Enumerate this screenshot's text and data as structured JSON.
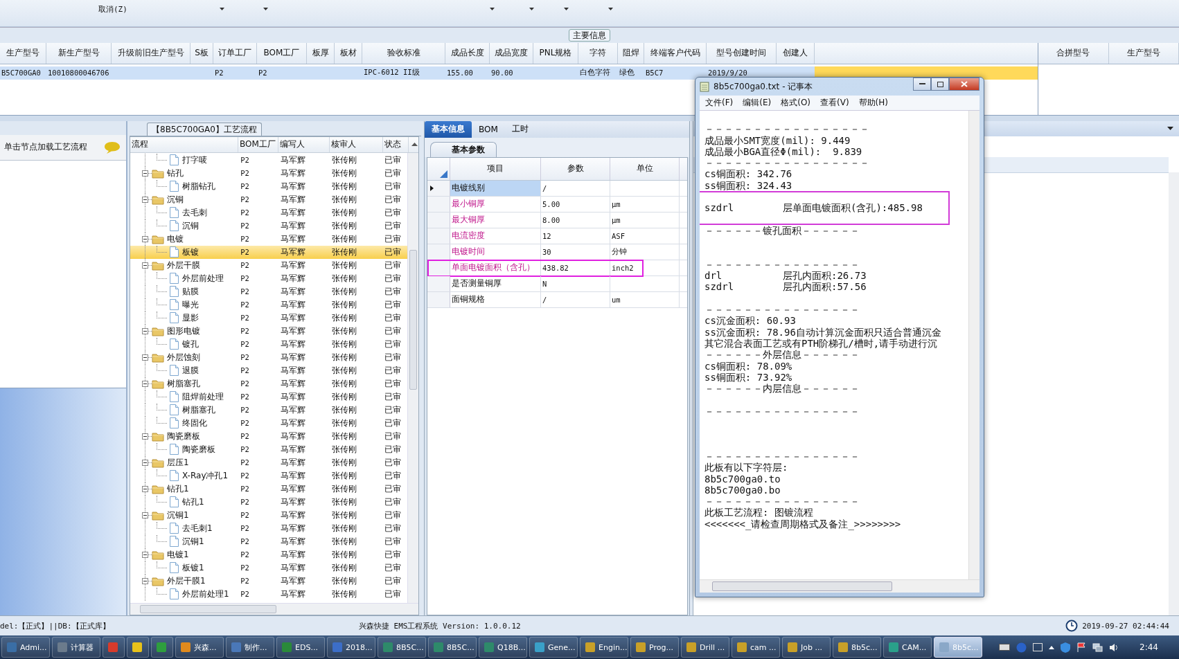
{
  "toolbar": {
    "cancel_label": "取消(Z)"
  },
  "main_info": {
    "title": "主要信息",
    "row_selected": true,
    "columns": [
      {
        "label": "生产型号",
        "value": "B5C700GA0"
      },
      {
        "label": "新生产型号",
        "value": "10010800046706"
      },
      {
        "label": "升级前旧生产型号"
      },
      {
        "label": "S板"
      },
      {
        "label": "订单工厂",
        "value": "P2"
      },
      {
        "label": "BOM工厂",
        "value": "P2"
      },
      {
        "label": "板厚"
      },
      {
        "label": "板材"
      },
      {
        "label": "验收标准",
        "value": "IPC-6012 II级"
      },
      {
        "label": "成品长度",
        "value": "155.00"
      },
      {
        "label": "成品宽度",
        "value": "90.00"
      },
      {
        "label": "PNL规格"
      },
      {
        "label": "字符",
        "value": "白色字符"
      },
      {
        "label": "阻焊",
        "value": "绿色"
      },
      {
        "label": "终端客户代码",
        "value": "B5C7"
      },
      {
        "label": "型号创建时间",
        "value": "2019/9/20"
      },
      {
        "label": "创建人"
      }
    ],
    "side_columns": [
      "合拼型号",
      "生产型号"
    ]
  },
  "left_panel": {
    "hint": "单击节点加载工艺流程"
  },
  "tree_panel": {
    "title": "【8B5C700GA0】工艺流程",
    "columns": [
      "流程",
      "BOM工厂",
      "编写人",
      "核审人",
      "状态"
    ],
    "nodes": [
      {
        "name": "打字唛",
        "kind": "file",
        "bom": "P2",
        "writer": "马军辉",
        "reviewer": "张传刚",
        "status": "已审",
        "selected": false
      },
      {
        "name": "钻孔",
        "kind": "folder",
        "expanded": true,
        "bom": "P2",
        "writer": "马军辉",
        "reviewer": "张传刚",
        "status": "已审",
        "selected": false,
        "children": [
          {
            "name": "树脂钻孔",
            "kind": "file",
            "bom": "P2",
            "writer": "马军辉",
            "reviewer": "张传刚",
            "status": "已审",
            "selected": false
          }
        ]
      },
      {
        "name": "沉铜",
        "kind": "folder",
        "expanded": true,
        "bom": "P2",
        "writer": "马军辉",
        "reviewer": "张传刚",
        "status": "已审",
        "selected": false,
        "children": [
          {
            "name": "去毛刺",
            "kind": "file",
            "bom": "P2",
            "writer": "马军辉",
            "reviewer": "张传刚",
            "status": "已审",
            "selected": false
          },
          {
            "name": "沉铜",
            "kind": "file",
            "bom": "P2",
            "writer": "马军辉",
            "reviewer": "张传刚",
            "status": "已审",
            "selected": false
          }
        ]
      },
      {
        "name": "电镀",
        "kind": "folder",
        "expanded": true,
        "bom": "P2",
        "writer": "马军辉",
        "reviewer": "张传刚",
        "status": "已审",
        "selected": false,
        "children": [
          {
            "name": "板镀",
            "kind": "file",
            "bom": "P2",
            "writer": "马军辉",
            "reviewer": "张传刚",
            "status": "已审",
            "selected": true
          }
        ]
      },
      {
        "name": "外层干膜",
        "kind": "folder",
        "expanded": true,
        "bom": "P2",
        "writer": "马军辉",
        "reviewer": "张传刚",
        "status": "已审",
        "selected": false,
        "children": [
          {
            "name": "外层前处理",
            "kind": "file",
            "bom": "P2",
            "writer": "马军辉",
            "reviewer": "张传刚",
            "status": "已审",
            "selected": false
          },
          {
            "name": "贴膜",
            "kind": "file",
            "bom": "P2",
            "writer": "马军辉",
            "reviewer": "张传刚",
            "status": "已审",
            "selected": false
          },
          {
            "name": "曝光",
            "kind": "file",
            "bom": "P2",
            "writer": "马军辉",
            "reviewer": "张传刚",
            "status": "已审",
            "selected": false
          },
          {
            "name": "显影",
            "kind": "file",
            "bom": "P2",
            "writer": "马军辉",
            "reviewer": "张传刚",
            "status": "已审",
            "selected": false
          }
        ]
      },
      {
        "name": "图形电镀",
        "kind": "folder",
        "expanded": true,
        "bom": "P2",
        "writer": "马军辉",
        "reviewer": "张传刚",
        "status": "已审",
        "selected": false,
        "children": [
          {
            "name": "镀孔",
            "kind": "file",
            "bom": "P2",
            "writer": "马军辉",
            "reviewer": "张传刚",
            "status": "已审",
            "selected": false
          }
        ]
      },
      {
        "name": "外层蚀刻",
        "kind": "folder",
        "expanded": true,
        "bom": "P2",
        "writer": "马军辉",
        "reviewer": "张传刚",
        "status": "已审",
        "selected": false,
        "children": [
          {
            "name": "退膜",
            "kind": "file",
            "bom": "P2",
            "writer": "马军辉",
            "reviewer": "张传刚",
            "status": "已审",
            "selected": false
          }
        ]
      },
      {
        "name": "树脂塞孔",
        "kind": "folder",
        "expanded": true,
        "bom": "P2",
        "writer": "马军辉",
        "reviewer": "张传刚",
        "status": "已审",
        "selected": false,
        "children": [
          {
            "name": "阻焊前处理",
            "kind": "file",
            "bom": "P2",
            "writer": "马军辉",
            "reviewer": "张传刚",
            "status": "已审",
            "selected": false
          },
          {
            "name": "树脂塞孔",
            "kind": "file",
            "bom": "P2",
            "writer": "马军辉",
            "reviewer": "张传刚",
            "status": "已审",
            "selected": false
          },
          {
            "name": "终固化",
            "kind": "file",
            "bom": "P2",
            "writer": "马军辉",
            "reviewer": "张传刚",
            "status": "已审",
            "selected": false
          }
        ]
      },
      {
        "name": "陶瓷磨板",
        "kind": "folder",
        "expanded": true,
        "bom": "P2",
        "writer": "马军辉",
        "reviewer": "张传刚",
        "status": "已审",
        "selected": false,
        "children": [
          {
            "name": "陶瓷磨板",
            "kind": "file",
            "bom": "P2",
            "writer": "马军辉",
            "reviewer": "张传刚",
            "status": "已审",
            "selected": false
          }
        ]
      },
      {
        "name": "层压1",
        "kind": "folder",
        "expanded": true,
        "bom": "P2",
        "writer": "马军辉",
        "reviewer": "张传刚",
        "status": "已审",
        "selected": false,
        "children": [
          {
            "name": "X-Ray冲孔1",
            "kind": "file",
            "bom": "P2",
            "writer": "马军辉",
            "reviewer": "张传刚",
            "status": "已审",
            "selected": false
          }
        ]
      },
      {
        "name": "钻孔1",
        "kind": "folder",
        "expanded": true,
        "bom": "P2",
        "writer": "马军辉",
        "reviewer": "张传刚",
        "status": "已审",
        "selected": false,
        "children": [
          {
            "name": "钻孔1",
            "kind": "file",
            "bom": "P2",
            "writer": "马军辉",
            "reviewer": "张传刚",
            "status": "已审",
            "selected": false
          }
        ]
      },
      {
        "name": "沉铜1",
        "kind": "folder",
        "expanded": true,
        "bom": "P2",
        "writer": "马军辉",
        "reviewer": "张传刚",
        "status": "已审",
        "selected": false,
        "children": [
          {
            "name": "去毛刺1",
            "kind": "file",
            "bom": "P2",
            "writer": "马军辉",
            "reviewer": "张传刚",
            "status": "已审",
            "selected": false
          },
          {
            "name": "沉铜1",
            "kind": "file",
            "bom": "P2",
            "writer": "马军辉",
            "reviewer": "张传刚",
            "status": "已审",
            "selected": false
          }
        ]
      },
      {
        "name": "电镀1",
        "kind": "folder",
        "expanded": true,
        "bom": "P2",
        "writer": "马军辉",
        "reviewer": "张传刚",
        "status": "已审",
        "selected": false,
        "children": [
          {
            "name": "板镀1",
            "kind": "file",
            "bom": "P2",
            "writer": "马军辉",
            "reviewer": "张传刚",
            "status": "已审",
            "selected": false
          }
        ]
      },
      {
        "name": "外层干膜1",
        "kind": "folder",
        "expanded": true,
        "bom": "P2",
        "writer": "马军辉",
        "reviewer": "张传刚",
        "status": "已审",
        "selected": false,
        "children": [
          {
            "name": "外层前处理1",
            "kind": "file",
            "bom": "P2",
            "writer": "马军辉",
            "reviewer": "张传刚",
            "status": "已审",
            "selected": false
          }
        ]
      }
    ]
  },
  "detail_panel": {
    "tabs": [
      {
        "label": "基本信息",
        "selected": true
      },
      {
        "label": "BOM",
        "selected": false
      },
      {
        "label": "工时",
        "selected": false
      }
    ],
    "subtab": "基本参数",
    "columns": [
      "项目",
      "参数",
      "单位"
    ],
    "rows": [
      {
        "item": "电镀线别",
        "value": "/",
        "required": false,
        "selected": true,
        "highlighted": false
      },
      {
        "item": "最小铜厚",
        "value": "5.00",
        "unit": "μm",
        "required": true,
        "selected": false,
        "highlighted": false
      },
      {
        "item": "最大铜厚",
        "value": "8.00",
        "unit": "μm",
        "required": true,
        "selected": false,
        "highlighted": false
      },
      {
        "item": "电流密度",
        "value": "12",
        "unit": "ASF",
        "required": true,
        "selected": false,
        "highlighted": false
      },
      {
        "item": "电镀时间",
        "value": "30",
        "unit": "分钟",
        "required": true,
        "selected": false,
        "highlighted": false
      },
      {
        "item": "单面电镀面积（含孔）",
        "value": "438.82",
        "unit": "inch2",
        "required": true,
        "selected": false,
        "highlighted": true
      },
      {
        "item": "是否测量铜厚",
        "value": "N",
        "required": false,
        "selected": false,
        "highlighted": false
      },
      {
        "item": "面铜规格",
        "value": "/",
        "unit": "um",
        "required": false,
        "selected": false,
        "highlighted": false
      }
    ]
  },
  "notepad": {
    "title": "8b5c700ga0.txt - 记事本",
    "menu": [
      "文件(F)",
      "编辑(E)",
      "格式(O)",
      "查看(V)",
      "帮助(H)"
    ],
    "lines": [
      {
        "kind": "blank"
      },
      {
        "kind": "text",
        "text": "－－－－－－－－－－－－－－－－－"
      },
      {
        "kind": "text",
        "text": "成品最小SMT宽度(mil): 9.449"
      },
      {
        "kind": "text",
        "text": "成品最小BGA直径Φ(mil):  9.839"
      },
      {
        "kind": "text",
        "text": "－－－－－－－－－－－－－－－－－"
      },
      {
        "kind": "text",
        "text": "cs铜面积: 342.76"
      },
      {
        "kind": "text",
        "text": "ss铜面积: 324.43"
      },
      {
        "kind": "text",
        "text": "szdrl\t层单面电镀面积(含孔):485.98",
        "highlighted": true
      },
      {
        "kind": "text",
        "text": "－－－－－－镀孔面积－－－－－－"
      },
      {
        "kind": "blank"
      },
      {
        "kind": "blank"
      },
      {
        "kind": "text",
        "text": "－－－－－－－－－－－－－－－－"
      },
      {
        "kind": "text",
        "text": "drl\t层孔内面积:26.73"
      },
      {
        "kind": "text",
        "text": "szdrl\t层孔内面积:57.56"
      },
      {
        "kind": "blank"
      },
      {
        "kind": "text",
        "text": "－－－－－－－－－－－－－－－－"
      },
      {
        "kind": "text",
        "text": "cs沉金面积: 60.93"
      },
      {
        "kind": "text",
        "text": "ss沉金面积: 78.96自动计算沉金面积只适合普通沉金"
      },
      {
        "kind": "text",
        "text": "其它混合表面工艺或有PTH阶梯孔/槽时,请手动进行沉"
      },
      {
        "kind": "text",
        "text": "－－－－－－外层信息－－－－－－"
      },
      {
        "kind": "text",
        "text": "cs铜面积: 78.09%"
      },
      {
        "kind": "text",
        "text": "ss铜面积: 73.92%"
      },
      {
        "kind": "text",
        "text": "－－－－－－内层信息－－－－－－"
      },
      {
        "kind": "blank"
      },
      {
        "kind": "text",
        "text": "－－－－－－－－－－－－－－－－"
      },
      {
        "kind": "blank"
      },
      {
        "kind": "blank"
      },
      {
        "kind": "blank"
      },
      {
        "kind": "text",
        "text": "－－－－－－－－－－－－－－－－"
      },
      {
        "kind": "text",
        "text": "此板有以下字符层:"
      },
      {
        "kind": "text",
        "text": "8b5c700ga0.to"
      },
      {
        "kind": "text",
        "text": "8b5c700ga0.bo"
      },
      {
        "kind": "text",
        "text": "－－－－－－－－－－－－－－－－"
      },
      {
        "kind": "text",
        "text": "此板工艺流程: 图镀流程"
      },
      {
        "kind": "text",
        "text": "<<<<<<<_请检查周期格式及备注_>>>>>>>>"
      }
    ]
  },
  "status_bar": {
    "mode": "del:【正式】||DB:【正式库】",
    "app": "兴森快捷 EMS工程系统 Version: 1.0.0.12",
    "datetime": "2019-09-27 02:44:44"
  },
  "taskbar": {
    "clock": "2:44",
    "items": [
      {
        "label": "Admi...",
        "color": "#3a6ea5",
        "selected": false
      },
      {
        "label": "计算器",
        "color": "#6b7b8c",
        "selected": false
      },
      {
        "color": "#d83b2b",
        "selected": false
      },
      {
        "color": "#e8c21a",
        "selected": false
      },
      {
        "color": "#2e9e3e",
        "selected": false
      },
      {
        "label": "兴森...",
        "color": "#e08a1e",
        "selected": false
      },
      {
        "label": "制作...",
        "color": "#4a78b8",
        "selected": false
      },
      {
        "label": "EDS...",
        "color": "#2a8a3a",
        "selected": false
      },
      {
        "label": "2018...",
        "color": "#3c6ec8",
        "selected": false
      },
      {
        "label": "8B5C...",
        "color": "#2e8a6a",
        "selected": false
      },
      {
        "label": "8B5C...",
        "color": "#2e8a6a",
        "selected": false
      },
      {
        "label": "Q18B...",
        "color": "#2e8a6a",
        "selected": false
      },
      {
        "label": "Gene...",
        "color": "#3aa0c8",
        "selected": false
      },
      {
        "label": "Engin...",
        "color": "#c8a028",
        "selected": false
      },
      {
        "label": "Prog...",
        "color": "#c8a028",
        "selected": false
      },
      {
        "label": "Drill ...",
        "color": "#c8a028",
        "selected": false
      },
      {
        "label": "cam ...",
        "color": "#c8a028",
        "selected": false
      },
      {
        "label": "Job ...",
        "color": "#c8a028",
        "selected": false
      },
      {
        "label": "8b5c...",
        "color": "#c8a028",
        "selected": false
      },
      {
        "label": "CAM...",
        "color": "#2aa08a",
        "selected": false
      },
      {
        "label": "8b5c...",
        "color": "#8aa8c8",
        "selected": true
      }
    ]
  }
}
